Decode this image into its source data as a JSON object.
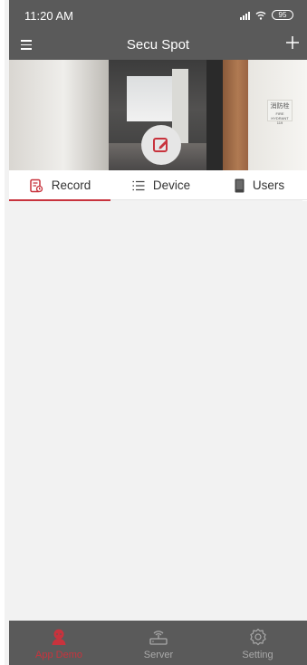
{
  "status_bar": {
    "time": "11:20 AM",
    "battery": "95"
  },
  "header": {
    "title": "Secu Spot"
  },
  "banner": {
    "sign_text": "消防栓",
    "sign_subtext": "FIRE HYDRANT 119"
  },
  "tabs": [
    {
      "label": "Record",
      "icon": "record-icon",
      "selected": true
    },
    {
      "label": "Device",
      "icon": "list-icon",
      "selected": false
    },
    {
      "label": "Users",
      "icon": "phone-icon",
      "selected": false
    }
  ],
  "bottom_nav": [
    {
      "label": "App Demo",
      "icon": "user-icon",
      "active": true
    },
    {
      "label": "Server",
      "icon": "router-icon",
      "active": false
    },
    {
      "label": "Setting",
      "icon": "gear-icon",
      "active": false
    }
  ],
  "colors": {
    "accent": "#c8333d",
    "bar": "#5a5a5a",
    "background": "#f2f2f2"
  }
}
